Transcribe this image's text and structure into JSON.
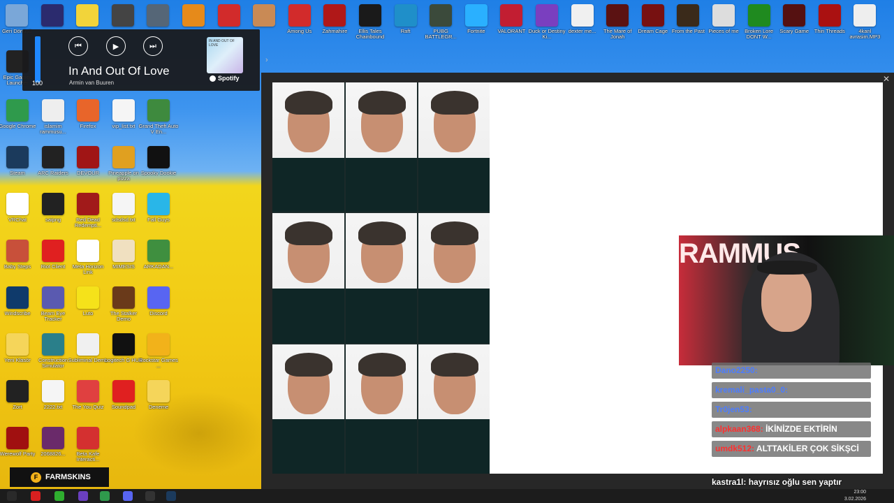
{
  "desktop": {
    "top_row_icons": [
      {
        "label": "Geri Dönüşü",
        "color": "#7aa7d8"
      },
      {
        "label": "",
        "color": "#2b2b6e"
      },
      {
        "label": "",
        "color": "#f2d43a"
      },
      {
        "label": "",
        "color": "#444444"
      },
      {
        "label": "",
        "color": "#556677"
      },
      {
        "label": "",
        "color": "#e68a1a"
      },
      {
        "label": "",
        "color": "#d22b2b"
      },
      {
        "label": "",
        "color": "#c98a55"
      },
      {
        "label": "Among Us",
        "color": "#d22b2b"
      },
      {
        "label": "Zahmahire",
        "color": "#b01818"
      },
      {
        "label": "Ellis Tales Chainbound",
        "color": "#1a1a1a"
      },
      {
        "label": "Raft",
        "color": "#1f8fc9"
      },
      {
        "label": "PUBG BATTLEGR...",
        "color": "#3b4a3b"
      },
      {
        "label": "Fortnite",
        "color": "#2ab0ff"
      },
      {
        "label": "VALORANT",
        "color": "#c21e32"
      },
      {
        "label": "Duck or Destiny Ki...",
        "color": "#7a3fbf"
      },
      {
        "label": "dexter me...",
        "color": "#f0f0f0"
      },
      {
        "label": "The Mare of Jonah",
        "color": "#5b1212"
      },
      {
        "label": "Dream Cage",
        "color": "#771111"
      },
      {
        "label": "From the Past",
        "color": "#3a2a1a"
      },
      {
        "label": "Pieces of me",
        "color": "#dddddd"
      },
      {
        "label": "Broken Lore DONT W...",
        "color": "#1f8a1f"
      },
      {
        "label": "Scary Game",
        "color": "#551111"
      },
      {
        "label": "Thin Threads",
        "color": "#aa1111"
      },
      {
        "label": "4kanl avrasim.MP3",
        "color": "#eeeeee"
      }
    ],
    "left_icons": [
      {
        "label": "Epic Games Launcher",
        "color": "#222222"
      },
      {
        "label": "Google Chrome",
        "color": "#2f9a4c"
      },
      {
        "label": "islamim rammusu...",
        "color": "#eeeeee"
      },
      {
        "label": "Firefox",
        "color": "#e8652a"
      },
      {
        "label": "vip_list.txt",
        "color": "#f5f5f5"
      },
      {
        "label": "Grand Theft Auto V En...",
        "color": "#3e8a3e"
      },
      {
        "label": "Steam",
        "color": "#1b3a5c"
      },
      {
        "label": "ARC Raiders",
        "color": "#222222"
      },
      {
        "label": "DEVOUR",
        "color": "#a01515"
      },
      {
        "label": "Pineapple on pizza",
        "color": "#e0a020"
      },
      {
        "label": "Spooky Dookie",
        "color": "#111111"
      },
      {
        "label": "VRChat",
        "color": "#ffffff"
      },
      {
        "label": "saipng",
        "color": "#222222"
      },
      {
        "label": "Red Dead Redempti...",
        "color": "#a11a1a"
      },
      {
        "label": "sdsdsd.txt",
        "color": "#f5f5f5"
      },
      {
        "label": "Fall Guys",
        "color": "#29b6e8"
      },
      {
        "label": "Baby Steps",
        "color": "#c8503a"
      },
      {
        "label": "Riot Client",
        "color": "#e02020"
      },
      {
        "label": "Meta Horizon Link",
        "color": "#ffffff"
      },
      {
        "label": "MIMESIS",
        "color": "#f0e0c0"
      },
      {
        "label": "ARKADAN...",
        "color": "#3f8f3f"
      },
      {
        "label": "Windscribe",
        "color": "#0f3a6b"
      },
      {
        "label": "Beam Eye Tracker",
        "color": "#5a5ab0"
      },
      {
        "label": "Luto",
        "color": "#f5e21a"
      },
      {
        "label": "The Stalker Demo",
        "color": "#6a3a1a"
      },
      {
        "label": "Discord",
        "color": "#5865f2"
      },
      {
        "label": "Yeni Klasör",
        "color": "#f5d55a"
      },
      {
        "label": "Construction Simulator",
        "color": "#2a7f8a"
      },
      {
        "label": "Subliminal Demo",
        "color": "#f0f0f0"
      },
      {
        "label": "Logitech G HUB",
        "color": "#111111"
      },
      {
        "label": "Rockstar Games ...",
        "color": "#f2b21a"
      },
      {
        "label": "Zort",
        "color": "#222222"
      },
      {
        "label": "2222.txt",
        "color": "#f5f5f5"
      },
      {
        "label": "The You Quiz",
        "color": "#e04040"
      },
      {
        "label": "Soundpad",
        "color": "#e02020"
      },
      {
        "label": "Deneme",
        "color": "#f5d55a"
      },
      {
        "label": "Werewolf Party",
        "color": "#a01010"
      },
      {
        "label": "2068826...",
        "color": "#6a2a6a"
      },
      {
        "label": "Beta Kafe Interacti...",
        "color": "#d43030"
      }
    ]
  },
  "spotify": {
    "volume": 100,
    "volume_text": "100",
    "prev_icon": "⏮",
    "play_icon": "▶",
    "next_icon": "⏭",
    "title": "In And Out Of Love",
    "artist": "Armin van Buuren",
    "cover_text": "IN AND OUT OF LOVE",
    "brand": "Spotify"
  },
  "viewer": {
    "close_icon": "✕",
    "photos": [
      {
        "style": "top"
      },
      {
        "style": "top"
      },
      {
        "style": "top"
      },
      {
        "style": "dark"
      },
      {
        "style": "dark"
      },
      {
        "style": "dark"
      },
      {
        "style": "dark"
      },
      {
        "style": "dark"
      },
      {
        "style": "dark"
      }
    ]
  },
  "webcam": {
    "banner": "RAMMUS"
  },
  "chat": {
    "messages": [
      {
        "user": "Dano2250:",
        "user_color": "blue",
        "text": ""
      },
      {
        "user": "kremali_pasta0_0:",
        "user_color": "blue",
        "text": ""
      },
      {
        "user": "Tr0jen53:",
        "user_color": "blue",
        "text": ""
      },
      {
        "user": "alpkaan368:",
        "user_color": "red",
        "text": "İKİNİZDE EKTİRİN"
      },
      {
        "user": "umdk512:",
        "user_color": "red",
        "text": "ALTTAKİLER ÇOK SİKŞCİ"
      }
    ],
    "last_user": "kastra1l:",
    "last_text": "hayrısız oğlu sen yaptır"
  },
  "farmskins": {
    "label": "FARMSKINS",
    "coin": "F"
  },
  "taskbar": {
    "time": "23:00",
    "date": "3.02.2026"
  }
}
